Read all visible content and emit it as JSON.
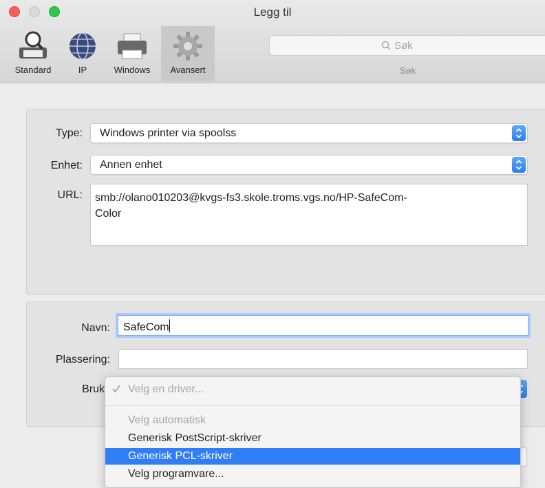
{
  "window": {
    "title": "Legg til"
  },
  "toolbar": {
    "items": [
      {
        "label": "Standard",
        "icon": "standard-printer-magnifier-icon"
      },
      {
        "label": "IP",
        "icon": "globe-icon"
      },
      {
        "label": "Windows",
        "icon": "printer-icon"
      },
      {
        "label": "Avansert",
        "icon": "gear-icon",
        "selected": true
      }
    ],
    "search": {
      "placeholder": "Søk",
      "caption": "Søk"
    }
  },
  "form": {
    "type": {
      "label": "Type:",
      "value": "Windows printer via spoolss"
    },
    "device": {
      "label": "Enhet:",
      "value": "Annen enhet"
    },
    "url": {
      "label": "URL:",
      "line1": "smb://olano010203@kvgs-fs3.skole.troms.vgs.no/HP-SafeCom-",
      "line2": "Color"
    },
    "name": {
      "label": "Navn:",
      "value": "SafeCom"
    },
    "location": {
      "label": "Plassering:",
      "value": ""
    },
    "use": {
      "label": "Bruk"
    }
  },
  "driver_menu": {
    "selected": "Velg en driver...",
    "items": [
      {
        "label": "Velg automatisk",
        "state": "disabled"
      },
      {
        "label": "Generisk PostScript-skriver",
        "state": "normal"
      },
      {
        "label": "Generisk PCL-skriver",
        "state": "highlighted"
      },
      {
        "label": "Velg programvare...",
        "state": "normal"
      }
    ]
  },
  "colors": {
    "accent": "#2f7ef6",
    "close": "#fc5f57",
    "zoom": "#32c649"
  }
}
